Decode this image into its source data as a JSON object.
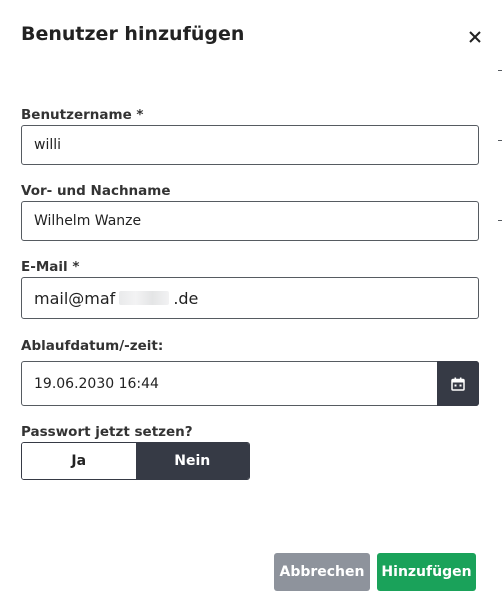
{
  "dialog": {
    "title": "Benutzer hinzufügen",
    "close_icon": "close-icon"
  },
  "fields": {
    "username": {
      "label": "Benutzername *",
      "value": "willi"
    },
    "fullname": {
      "label": "Vor- und Nachname",
      "value": "Wilhelm Wanze"
    },
    "email": {
      "label": "E-Mail *",
      "value_prefix": "mail@maf",
      "value_suffix": ".de"
    },
    "expiry": {
      "label": "Ablaufdatum/-zeit:",
      "value": "19.06.2030 16:44",
      "icon": "calendar-icon"
    },
    "password": {
      "label": "Passwort jetzt setzen?",
      "options": [
        "Ja",
        "Nein"
      ],
      "selected": "Nein"
    }
  },
  "actions": {
    "cancel_label": "Abbrechen",
    "add_label": "Hinzufügen"
  },
  "colors": {
    "dark": "#363a45",
    "cancel": "#8e939c",
    "add": "#1aa25a"
  }
}
